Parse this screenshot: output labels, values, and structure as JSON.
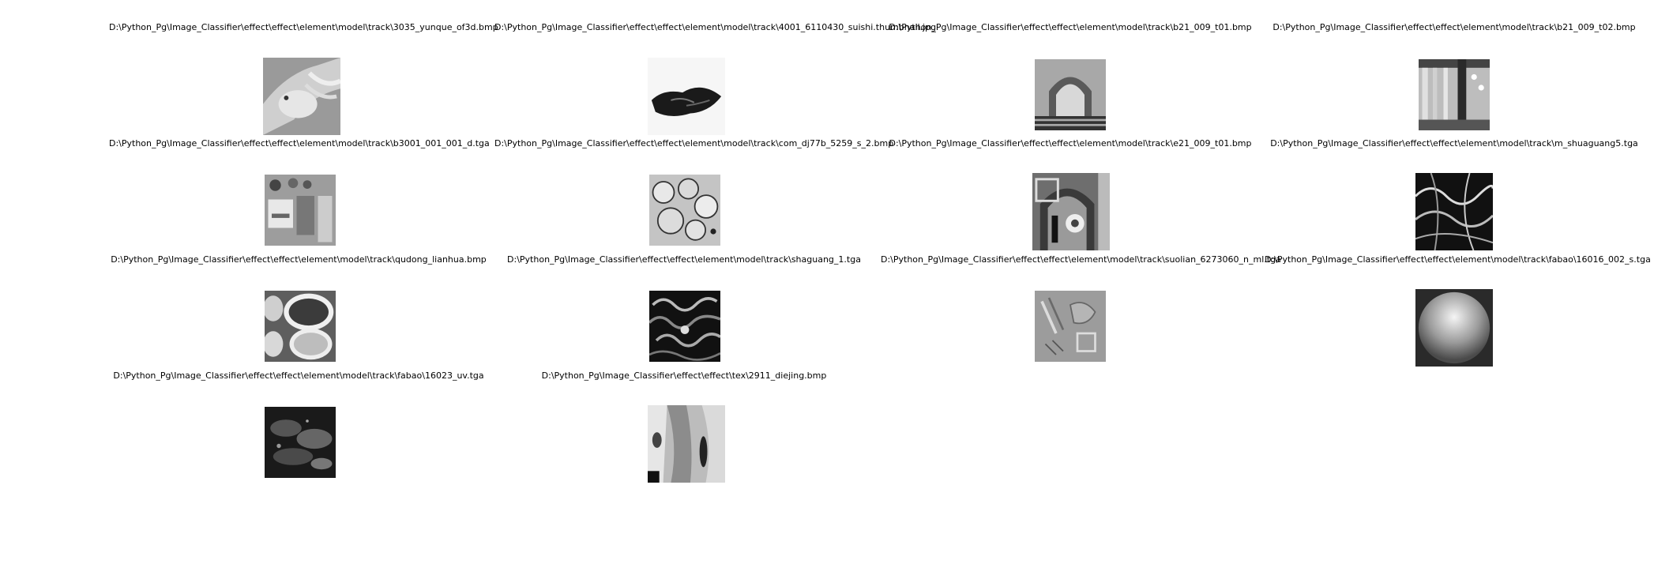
{
  "figure": {
    "items": [
      {
        "title": "D:\\Python_Pg\\Image_Classifier\\effect\\effect\\element\\model\\track\\3035_yunque_of3d.bmp",
        "thumb_icon": "bird-texture-thumbnail"
      },
      {
        "title": "D:\\Python_Pg\\Image_Classifier\\effect\\effect\\element\\model\\track\\4001_6110430_suishi.thumbnail.jpg",
        "thumb_icon": "rock-fragment-thumbnail"
      },
      {
        "title": "D:\\Python_Pg\\Image_Classifier\\effect\\effect\\element\\model\\track\\b21_009_t01.bmp",
        "thumb_icon": "arch-texture-thumbnail"
      },
      {
        "title": "D:\\Python_Pg\\Image_Classifier\\effect\\effect\\element\\model\\track\\b21_009_t02.bmp",
        "thumb_icon": "curtain-texture-thumbnail"
      },
      {
        "title": "D:\\Python_Pg\\Image_Classifier\\effect\\effect\\element\\model\\track\\b3001_001_001_d.tga",
        "thumb_icon": "atlas-texture-thumbnail"
      },
      {
        "title": "D:\\Python_Pg\\Image_Classifier\\effect\\effect\\element\\model\\track\\com_dj77b_5259_s_2.bmp",
        "thumb_icon": "scales-texture-thumbnail"
      },
      {
        "title": "D:\\Python_Pg\\Image_Classifier\\effect\\effect\\element\\model\\track\\e21_009_t01.bmp",
        "thumb_icon": "ornament-texture-thumbnail"
      },
      {
        "title": "D:\\Python_Pg\\Image_Classifier\\effect\\effect\\element\\model\\track\\m_shuaguang5.tga",
        "thumb_icon": "caustics-texture-thumbnail"
      },
      {
        "title": "D:\\Python_Pg\\Image_Classifier\\effect\\effect\\element\\model\\track\\qudong_lianhua.bmp",
        "thumb_icon": "petals-texture-thumbnail"
      },
      {
        "title": "D:\\Python_Pg\\Image_Classifier\\effect\\effect\\element\\model\\track\\shaguang_1.tga",
        "thumb_icon": "noise-texture-thumbnail"
      },
      {
        "title": "D:\\Python_Pg\\Image_Classifier\\effect\\effect\\element\\model\\track\\suolian_6273060_n_ml.tga",
        "thumb_icon": "normal-map-thumbnail"
      },
      {
        "title": "D:\\Python_Pg\\Image_Classifier\\effect\\effect\\element\\model\\track\\fabao\\16016_002_s.tga",
        "thumb_icon": "sphere-texture-thumbnail"
      },
      {
        "title": "D:\\Python_Pg\\Image_Classifier\\effect\\effect\\element\\model\\track\\fabao\\16023_uv.tga",
        "thumb_icon": "cloud-texture-thumbnail"
      },
      {
        "title": "D:\\Python_Pg\\Image_Classifier\\effect\\effect\\tex\\2911_diejing.bmp",
        "thumb_icon": "folds-texture-thumbnail"
      }
    ]
  }
}
